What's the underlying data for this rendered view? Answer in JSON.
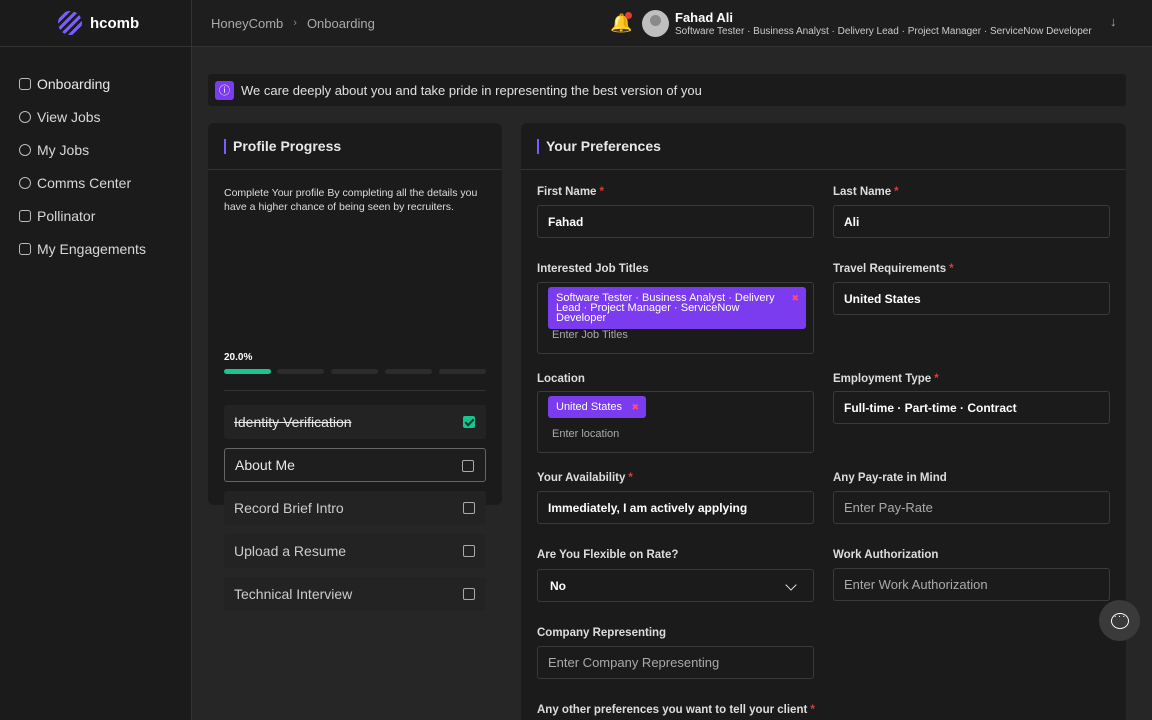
{
  "brand": {
    "name": "hcomb"
  },
  "sidebar": {
    "items": [
      {
        "label": "Onboarding",
        "icon": "onboarding-icon"
      },
      {
        "label": "View Jobs",
        "icon": "user-icon"
      },
      {
        "label": "My Jobs",
        "icon": "users-icon"
      },
      {
        "label": "Comms Center",
        "icon": "comms-icon"
      },
      {
        "label": "Pollinator",
        "icon": "document-icon"
      },
      {
        "label": "My Engagements",
        "icon": "briefcase-icon"
      }
    ]
  },
  "header": {
    "breadcrumb": [
      "HoneyComb",
      "Onboarding"
    ],
    "user": {
      "name": "Fahad Ali",
      "roles": "Software Tester · Business Analyst · Delivery Lead · Project Manager · ServiceNow Developer"
    }
  },
  "banner": {
    "text": "We care deeply about you and take pride in representing the best version of you"
  },
  "progress": {
    "title": "Profile Progress",
    "description": "Complete Your profile By completing all the details you have a higher chance of being seen by recruiters.",
    "percent_label": "20.0%",
    "percent": 20,
    "steps": [
      {
        "label": "Identity Verification",
        "done": true
      },
      {
        "label": "About Me",
        "done": false
      },
      {
        "label": "Record Brief Intro",
        "done": false
      },
      {
        "label": "Upload a Resume",
        "done": false
      },
      {
        "label": "Technical Interview",
        "done": false
      }
    ]
  },
  "preferences": {
    "title": "Your Preferences",
    "first_name": {
      "label": "First Name",
      "value": "Fahad"
    },
    "last_name": {
      "label": "Last Name",
      "value": "Ali"
    },
    "job_titles": {
      "label": "Interested Job Titles",
      "chip": "Software Tester · Business Analyst · Delivery Lead · Project Manager · ServiceNow Developer",
      "placeholder": "Enter Job Titles"
    },
    "travel": {
      "label": "Travel Requirements",
      "value": "United States"
    },
    "location": {
      "label": "Location",
      "chip": "United States",
      "placeholder": "Enter location"
    },
    "employment": {
      "label": "Employment Type",
      "value": "Full-time · Part-time · Contract"
    },
    "availability": {
      "label": "Your Availability",
      "value": "Immediately, I am actively applying"
    },
    "payrate": {
      "label": "Any Pay-rate in Mind",
      "placeholder": "Enter Pay-Rate"
    },
    "flexible": {
      "label": "Are You Flexible on Rate?",
      "value": "No"
    },
    "work_auth": {
      "label": "Work Authorization",
      "placeholder": "Enter Work Authorization"
    },
    "company": {
      "label": "Company Representing",
      "placeholder": "Enter Company Representing"
    },
    "other": {
      "label": "Any other preferences you want to tell your client"
    }
  },
  "required_mark": "*",
  "colors": {
    "accent": "#7b3cf0",
    "progress": "#19c48e",
    "required": "#e23b3b"
  }
}
